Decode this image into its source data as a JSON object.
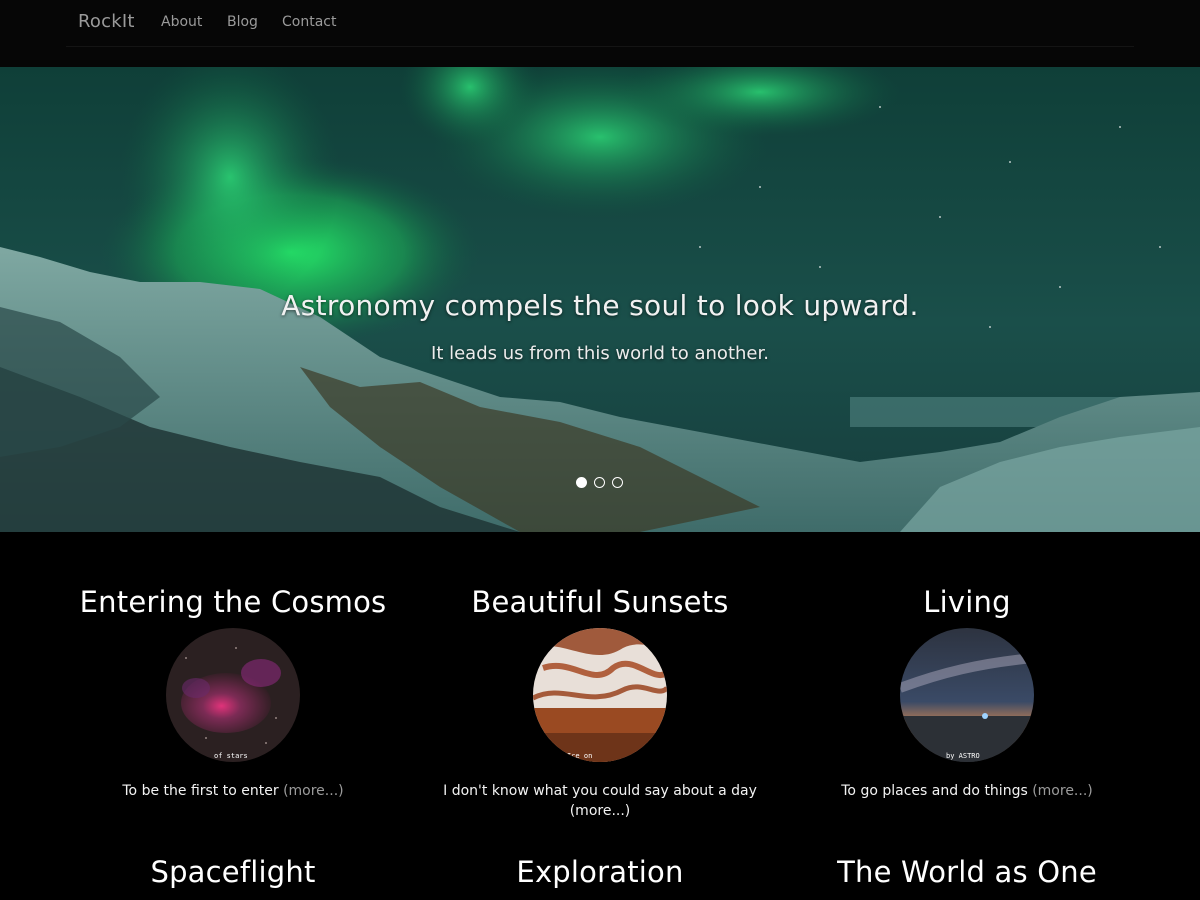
{
  "navbar": {
    "brand": "RockIt",
    "links": [
      "About",
      "Blog",
      "Contact"
    ]
  },
  "hero": {
    "title": "Astronomy compels the soul to look upward.",
    "subtitle": "It leads us from this world to another.",
    "slide_count": 3,
    "active_slide": 1
  },
  "features": [
    {
      "title": "Entering the Cosmos",
      "text": "To be the first to enter",
      "more": "(more...)",
      "thumb_caption": "of stars"
    },
    {
      "title": "Beautiful Sunsets",
      "text": "I don't know what you could say about a day",
      "more": "(more...)",
      "thumb_caption": "Ice on"
    },
    {
      "title": "Living",
      "text": "To go places and do things",
      "more": "(more...)",
      "thumb_caption": "by ASTRO"
    }
  ],
  "features_row2": [
    {
      "title": "Spaceflight"
    },
    {
      "title": "Exploration"
    },
    {
      "title": "The World as One"
    }
  ],
  "colors": {
    "background": "#000000",
    "navbar": "#060606",
    "nav_text": "#9a9a9a",
    "aurora": "#1fe36a",
    "more_link": "#9b9b9b"
  }
}
